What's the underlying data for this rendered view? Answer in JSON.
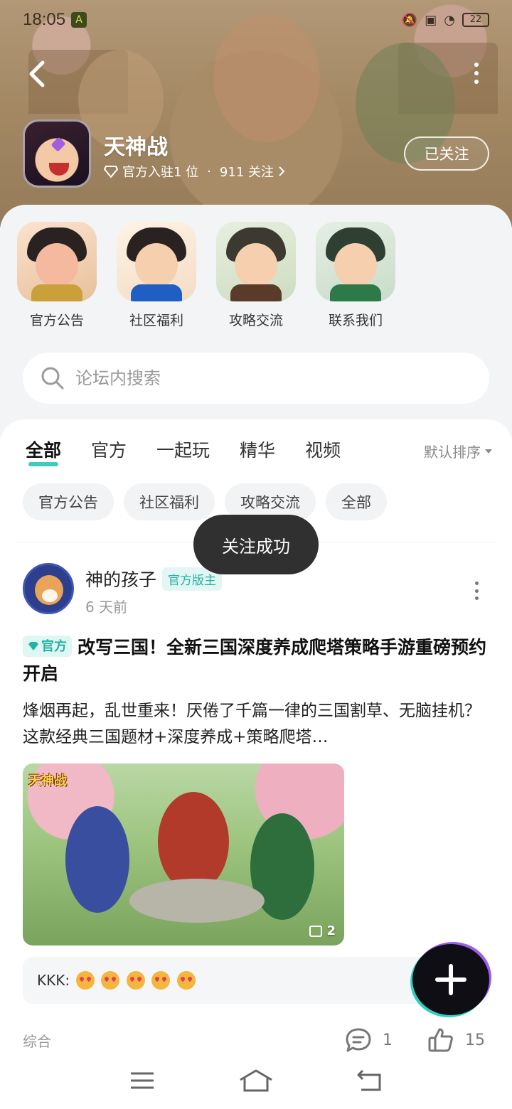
{
  "status_bar": {
    "time": "18:05",
    "battery": "22",
    "icons": [
      "mute-icon",
      "sim-icon",
      "wifi-icon",
      "battery-icon"
    ]
  },
  "header": {
    "forum_name": "天神战",
    "meta_official": "官方入驻1 位",
    "meta_separator": "·",
    "meta_followers": "911 关注",
    "follow_button": "已关注"
  },
  "shortcuts": [
    {
      "label": "官方公告",
      "icon": "official-announce-avatar"
    },
    {
      "label": "社区福利",
      "icon": "community-welfare-avatar"
    },
    {
      "label": "攻略交流",
      "icon": "strategy-exchange-avatar"
    },
    {
      "label": "联系我们",
      "icon": "contact-us-avatar"
    }
  ],
  "search": {
    "placeholder": "论坛内搜索"
  },
  "tabs": [
    "全部",
    "官方",
    "一起玩",
    "精华",
    "视频"
  ],
  "active_tab": "全部",
  "sort_label": "默认排序",
  "chips": [
    "官方公告",
    "社区福利",
    "攻略交流",
    "全部"
  ],
  "toast": "关注成功",
  "post": {
    "author": "神的孩子",
    "author_badge": "官方版主",
    "time": "6 天前",
    "official_tag": "官方",
    "title": "改写三国！全新三国深度养成爬塔策略手游重磅预约开启",
    "excerpt": "烽烟再起，乱世重来！厌倦了千篇一律的三国割草、无脑挂机？这款经典三国题材+深度养成+策略爬塔…",
    "image_wordmark": "天神战",
    "image_count": "2",
    "comment_user": "KKK:",
    "category": "综合",
    "comments": "1",
    "likes": "15"
  },
  "colors": {
    "accent": "#20c2b4",
    "toast_bg": "#303030",
    "fab_bg": "#0e0e14"
  }
}
